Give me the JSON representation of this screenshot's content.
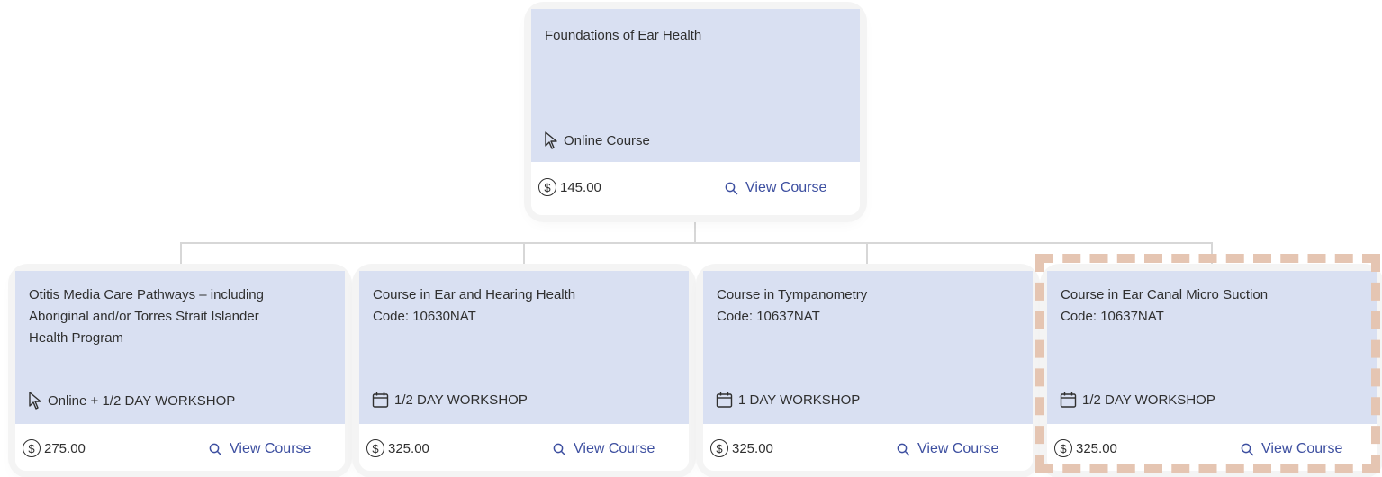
{
  "root_course": {
    "title": "Foundations of Ear Health",
    "format_icon": "cursor-icon",
    "format": "Online Course",
    "price": "145.00",
    "view_label": "View Course"
  },
  "child_courses": [
    {
      "title": "Otitis Media Care Pathways – including\nAboriginal and/or Torres Strait Islander\nHealth Program",
      "format_icon": "cursor-icon",
      "format": "Online + 1/2 DAY WORKSHOP",
      "price": "275.00",
      "view_label": "View Course"
    },
    {
      "title": "Course in Ear and Hearing Health\nCode: 10630NAT",
      "format_icon": "calendar-icon",
      "format": "1/2 DAY WORKSHOP",
      "price": "325.00",
      "view_label": "View Course"
    },
    {
      "title": "Course in Tympanometry\nCode: 10637NAT",
      "format_icon": "calendar-icon",
      "format": "1 DAY WORKSHOP",
      "price": "325.00",
      "view_label": "View Course"
    },
    {
      "title": "Course in Ear Canal Micro Suction\nCode: 10637NAT",
      "format_icon": "calendar-icon",
      "format": "1/2 DAY WORKSHOP",
      "price": "325.00",
      "view_label": "View Course"
    }
  ],
  "currency_symbol": "$",
  "colors": {
    "card_header": "#d9e0f2",
    "link": "#3d4fa0",
    "selection": "#e5c5b2"
  }
}
